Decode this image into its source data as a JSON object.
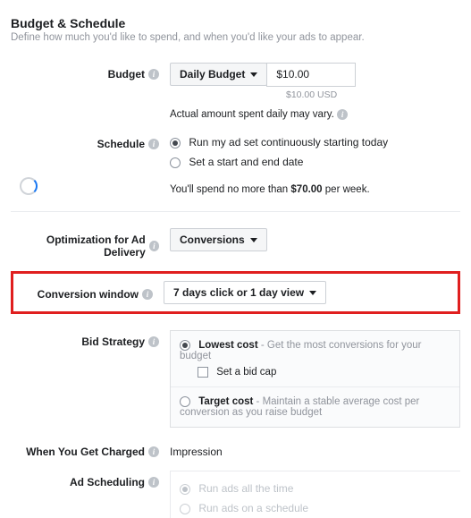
{
  "header": {
    "title": "Budget & Schedule",
    "subtitle": "Define how much you'd like to spend, and when you'd like your ads to appear."
  },
  "budget": {
    "label": "Budget",
    "type_label": "Daily Budget",
    "amount": "$10.00",
    "amount_hint": "$10.00 USD",
    "spend_note": "Actual amount spent daily may vary."
  },
  "schedule": {
    "label": "Schedule",
    "option_run": "Run my ad set continuously starting today",
    "option_set": "Set a start and end date",
    "limit_prefix": "You'll spend no more than ",
    "limit_amount": "$70.00",
    "limit_suffix": " per week."
  },
  "optimization": {
    "label": "Optimization for Ad Delivery",
    "value": "Conversions"
  },
  "conversion_window": {
    "label": "Conversion window",
    "value": "7 days click or 1 day view"
  },
  "bid_strategy": {
    "label": "Bid Strategy",
    "lowest_title": "Lowest cost",
    "lowest_desc": " - Get the most conversions for your budget",
    "bidcap_label": "Set a bid cap",
    "target_title": "Target cost",
    "target_desc": " - Maintain a stable average cost per conversion as you raise budget"
  },
  "charged": {
    "label": "When You Get Charged",
    "value": "Impression"
  },
  "ad_scheduling": {
    "label": "Ad Scheduling",
    "option_all": "Run ads all the time",
    "option_schedule": "Run ads on a schedule"
  }
}
